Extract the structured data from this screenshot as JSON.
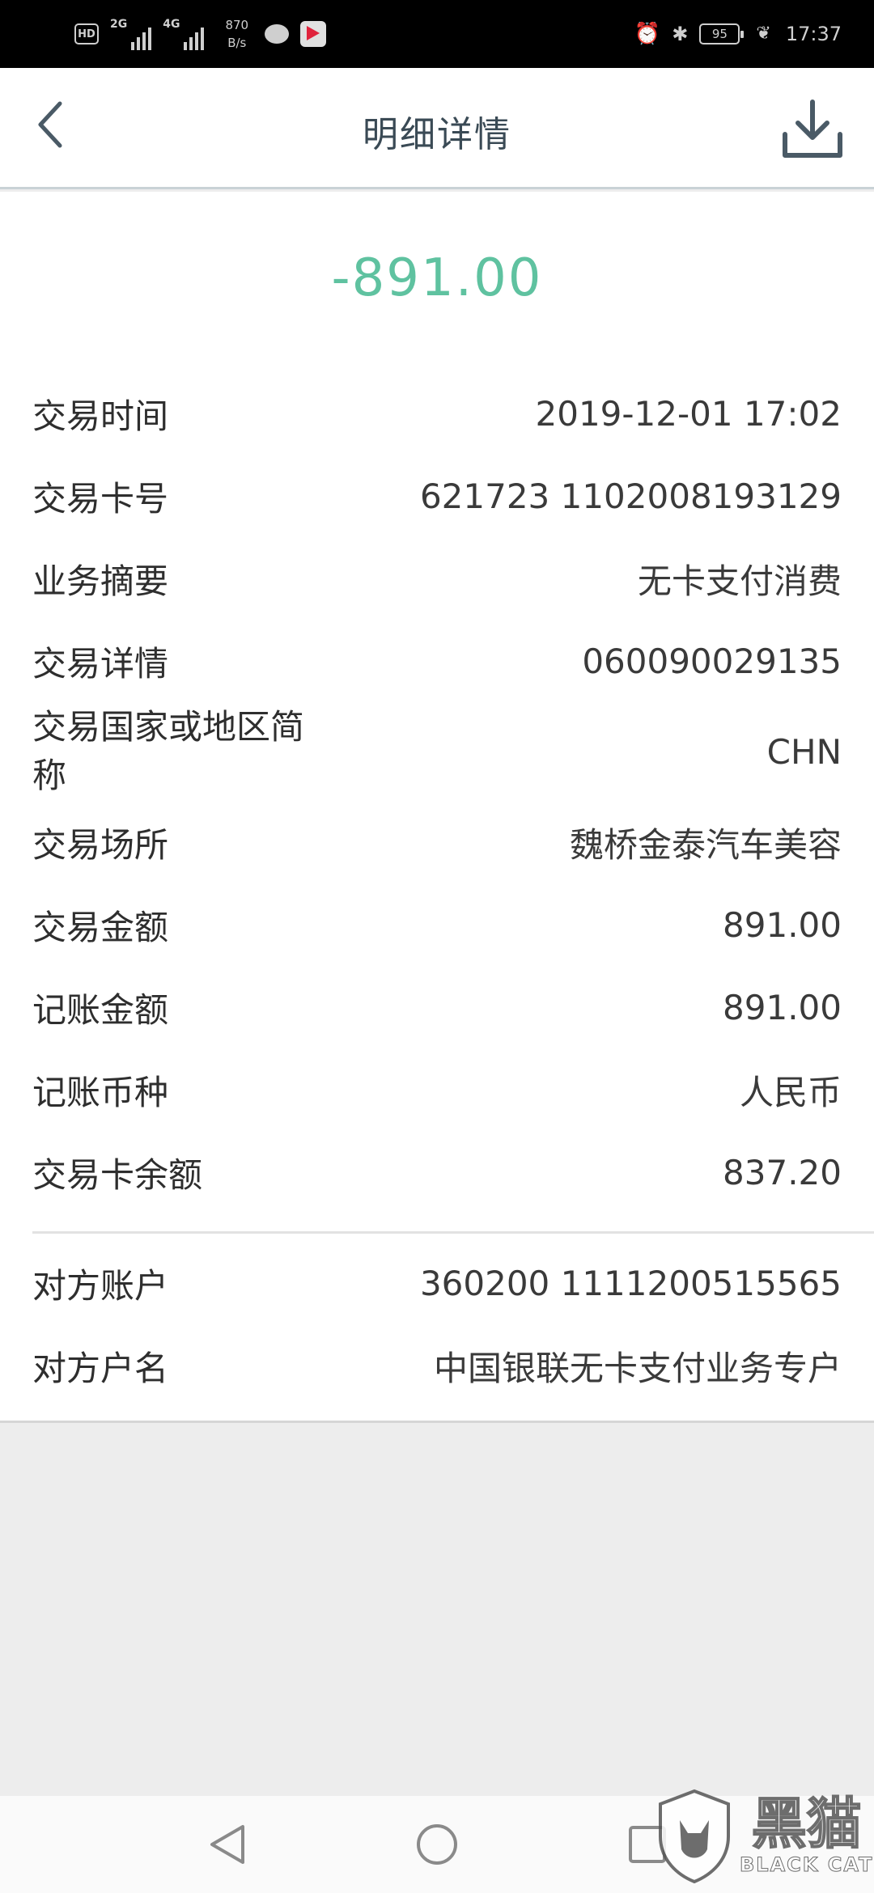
{
  "status_bar": {
    "hd": "HD",
    "net1": "2G",
    "net2": "4G",
    "speed_value": "870",
    "speed_unit": "B/s",
    "battery": "95",
    "time": "17:37"
  },
  "header": {
    "title": "明细详情"
  },
  "amount": "-891.00",
  "details": [
    {
      "label": "交易时间",
      "value": "2019-12-01 17:02"
    },
    {
      "label": "交易卡号",
      "value": "621723 1102008193129"
    },
    {
      "label": "业务摘要",
      "value": "无卡支付消费"
    },
    {
      "label": "交易详情",
      "value": "060090029135"
    },
    {
      "label": "交易国家或地区简称",
      "value": "CHN"
    },
    {
      "label": "交易场所",
      "value": "魏桥金泰汽车美容"
    },
    {
      "label": "交易金额",
      "value": "891.00"
    },
    {
      "label": "记账金额",
      "value": "891.00"
    },
    {
      "label": "记账币种",
      "value": "人民币"
    },
    {
      "label": "交易卡余额",
      "value": "837.20"
    }
  ],
  "counterparty": [
    {
      "label": "对方账户",
      "value": "360200 1111200515565"
    },
    {
      "label": "对方户名",
      "value": "中国银联无卡支付业务专户"
    }
  ],
  "watermark": {
    "cn": "黑猫",
    "en": "BLACK CAT"
  },
  "colors": {
    "amount": "#5fc2a0",
    "title": "#3a4a55",
    "status_bar_bg": "#000000",
    "page_bg": "#ededed"
  }
}
